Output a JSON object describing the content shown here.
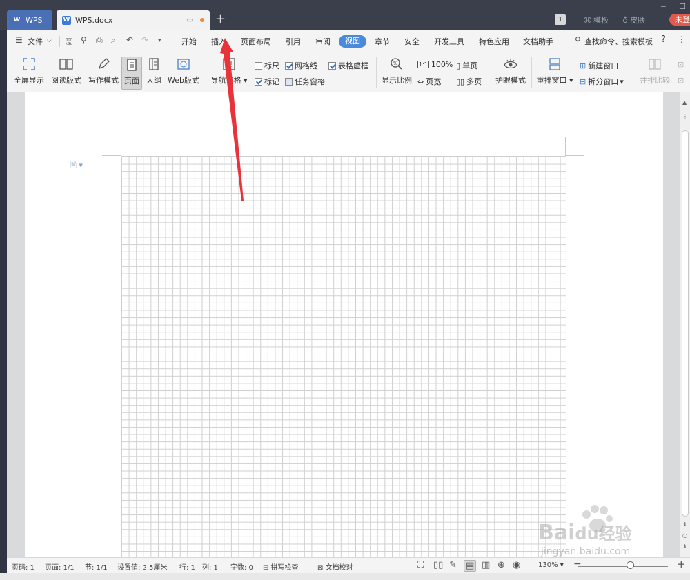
{
  "titlebar": {
    "app_tab": "WPS",
    "doc_tab": "WPS.docx",
    "template_label": "模板",
    "skin_label": "皮肤",
    "badge": "1",
    "login_label": "未登"
  },
  "menubar": {
    "file_label": "文件",
    "tabs": [
      "开始",
      "插入",
      "页面布局",
      "引用",
      "审阅",
      "视图",
      "章节",
      "安全",
      "开发工具",
      "特色应用",
      "文档助手"
    ],
    "active_tab": "视图",
    "search_placeholder": "查找命令、搜索模板",
    "help": "?"
  },
  "ribbon": {
    "fullscreen": "全屏显示",
    "read_mode": "阅读版式",
    "write_mode": "写作模式",
    "page": "页面",
    "outline": "大纲",
    "web": "Web版式",
    "nav_pane": "导航窗格",
    "ruler": "标尺",
    "gridlines": "网格线",
    "table_dashed": "表格虚框",
    "marks": "标记",
    "task_pane": "任务窗格",
    "zoom": "显示比例",
    "zoom_100": "100%",
    "page_width": "页宽",
    "single_page": "单页",
    "multi_page": "多页",
    "eye_mode": "护眼模式",
    "rearrange": "重排窗口",
    "new_window": "新建窗口",
    "split_window": "拆分窗口",
    "compare": "并排比较",
    "checks": {
      "ruler": false,
      "gridlines": true,
      "table_dashed": true,
      "marks": true,
      "task_pane": false
    }
  },
  "statusbar": {
    "page_num": "页码: 1",
    "pages": "页面: 1/1",
    "section": "节: 1/1",
    "setting": "设置值: 2.5厘米",
    "row": "行: 1",
    "col": "列: 1",
    "word_count": "字数: 0",
    "spell_check": "拼写检查",
    "doc_proof": "文档校对",
    "zoom_value": "130%"
  },
  "watermark": {
    "brand": "Bai",
    "brand2": "经验",
    "site": "jingyan.baidu.com"
  },
  "colors": {
    "titlebar_bg": "#3a3f4b",
    "accent": "#4a89dc",
    "login_red": "#e05a4e",
    "annotation_red": "#e8333a"
  }
}
